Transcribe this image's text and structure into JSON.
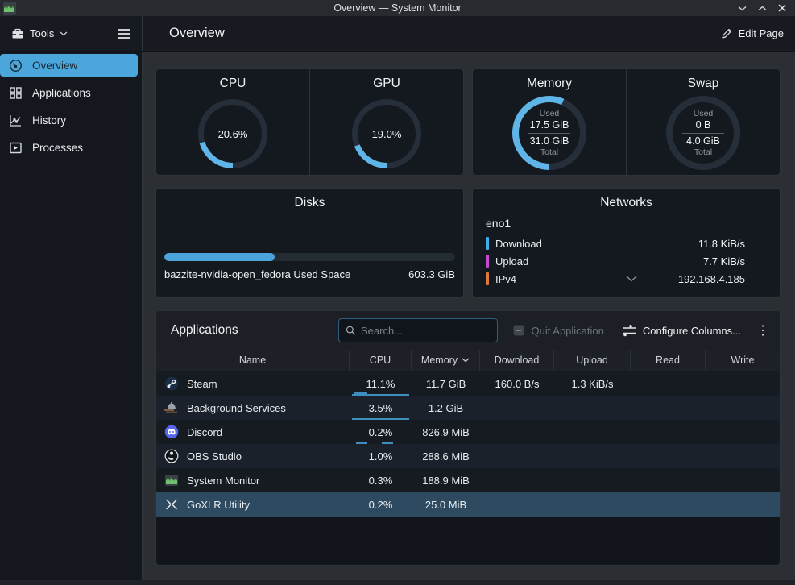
{
  "colors": {
    "accent": "#3daee9",
    "gauge_arc": "#60b5e8",
    "gauge_track": "#262f39",
    "disk_fill": "#4da4da",
    "download_bar": "#3daee9",
    "upload_bar": "#c44bd1",
    "ipv4_bar": "#dd7a3c",
    "selection": "#2d4a60"
  },
  "titlebar": {
    "title": "Overview — System Monitor"
  },
  "toolbar": {
    "tools_label": "Tools",
    "page_title": "Overview",
    "edit_page_label": "Edit Page"
  },
  "sidebar": {
    "items": [
      {
        "label": "Overview",
        "selected": true
      },
      {
        "label": "Applications",
        "selected": false
      },
      {
        "label": "History",
        "selected": false
      },
      {
        "label": "Processes",
        "selected": false
      }
    ]
  },
  "cards": {
    "cpu_gpu": {
      "gauges": [
        {
          "title": "CPU",
          "value": "20.6%",
          "percent": 20.6
        },
        {
          "title": "GPU",
          "value": "19.0%",
          "percent": 19.0
        }
      ]
    },
    "memory_swap": {
      "gauges": [
        {
          "title": "Memory",
          "used_label": "Used",
          "used": "17.5 GiB",
          "total": "31.0 GiB",
          "total_label": "Total",
          "percent": 56.5
        },
        {
          "title": "Swap",
          "used_label": "Used",
          "used": "0 B",
          "total": "4.0 GiB",
          "total_label": "Total",
          "percent": 0
        }
      ]
    },
    "disks": {
      "title": "Disks",
      "used_percent": 38,
      "label": "bazzite-nvidia-open_fedora Used Space",
      "value": "603.3 GiB"
    },
    "networks": {
      "title": "Networks",
      "interface": "eno1",
      "rows": [
        {
          "label": "Download",
          "value": "11.8 KiB/s"
        },
        {
          "label": "Upload",
          "value": "7.7 KiB/s"
        },
        {
          "label": "IPv4",
          "value": "192.168.4.185"
        }
      ]
    }
  },
  "applications": {
    "title": "Applications",
    "search_placeholder": "Search...",
    "quit_label": "Quit Application",
    "configure_label": "Configure Columns...",
    "overflow_icon": "⋮",
    "columns": [
      "Name",
      "CPU",
      "Memory",
      "Download",
      "Upload",
      "Read",
      "Write"
    ],
    "sort_column": "Memory",
    "rows": [
      {
        "name": "Steam",
        "cpu": "11.1%",
        "memory": "11.7 GiB",
        "download": "160.0 B/s",
        "upload": "1.3 KiB/s",
        "read": "",
        "write": "",
        "selected": false
      },
      {
        "name": "Background Services",
        "cpu": "3.5%",
        "memory": "1.2 GiB",
        "download": "",
        "upload": "",
        "read": "",
        "write": "",
        "selected": false
      },
      {
        "name": "Discord",
        "cpu": "0.2%",
        "memory": "826.9 MiB",
        "download": "",
        "upload": "",
        "read": "",
        "write": "",
        "selected": false
      },
      {
        "name": "OBS Studio",
        "cpu": "1.0%",
        "memory": "288.6 MiB",
        "download": "",
        "upload": "",
        "read": "",
        "write": "",
        "selected": false
      },
      {
        "name": "System Monitor",
        "cpu": "0.3%",
        "memory": "188.9 MiB",
        "download": "",
        "upload": "",
        "read": "",
        "write": "",
        "selected": false
      },
      {
        "name": "GoXLR Utility",
        "cpu": "0.2%",
        "memory": "25.0 MiB",
        "download": "",
        "upload": "",
        "read": "",
        "write": "",
        "selected": true
      }
    ]
  }
}
